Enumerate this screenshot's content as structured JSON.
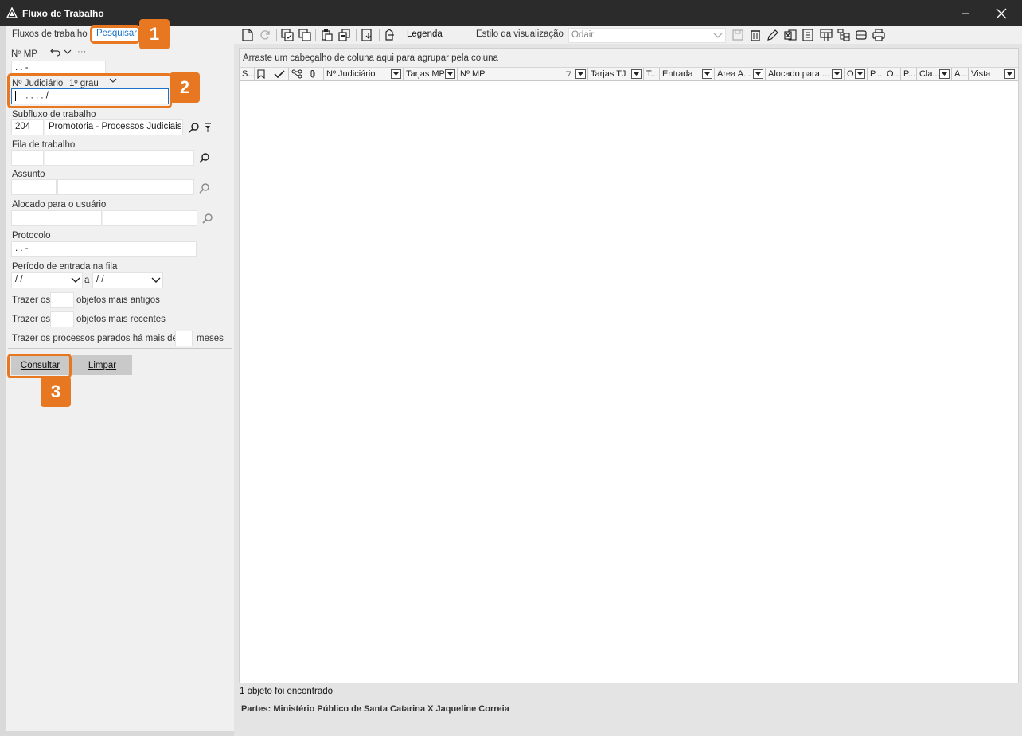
{
  "window": {
    "title": "Fluxo de Trabalho"
  },
  "tabs": {
    "fluxos": "Fluxos de trabalho",
    "pesquisar": "Pesquisar"
  },
  "form": {
    "nmp_label": "Nº MP",
    "nmp_value": " .  .      -",
    "njud_label": "Nº Judiciário",
    "njud_grau": "1º grau",
    "njud_value": "    -  .     .  .   .   /",
    "subfluxo_label": "Subfluxo de trabalho",
    "subfluxo_code": "204",
    "subfluxo_name": "Promotoria - Processos Judiciais",
    "fila_label": "Fila de trabalho",
    "fila_code": "",
    "fila_name": "",
    "assunto_label": "Assunto",
    "assunto_code": "",
    "assunto_name": "",
    "alocado_label": "Alocado para o usuário",
    "alocado_code": "",
    "alocado_name": "",
    "protocolo_label": "Protocolo",
    "protocolo_value": "  .  .        -",
    "periodo_label": "Período de entrada na fila",
    "periodo_de": " /  /",
    "periodo_a_label": "a",
    "periodo_ate": " /  /",
    "trazer_os": "Trazer os",
    "antigos_label": "objetos mais antigos",
    "antigos_value": "",
    "recentes_label": "objetos mais recentes",
    "recentes_value": "",
    "parados_label": "Trazer os processos parados há mais de",
    "parados_value": "",
    "meses_label": "meses",
    "consultar": "Consultar",
    "limpar": "Limpar"
  },
  "toolbar": {
    "legenda": "Legenda",
    "estilo_label": "Estilo da visualização",
    "estilo_value": "Odair"
  },
  "grid": {
    "group_hint": "Arraste um cabeçalho de coluna aqui para agrupar pela coluna",
    "columns": [
      "S...",
      "",
      "",
      "",
      "",
      "Nº Judiciário",
      "Tarjas MP",
      "Nº MP",
      "Tarjas TJ",
      "T...",
      "Entrada",
      "Área A...",
      "Alocado para ...",
      "O",
      "P...",
      "O...",
      "P...",
      "Cla...",
      "A...",
      "Vista"
    ]
  },
  "status": {
    "found": "1 objeto foi encontrado",
    "partes": "Partes: Ministério Público de Santa Catarina  X  Jaqueline Correia"
  },
  "callouts": [
    "1",
    "2",
    "3"
  ],
  "colors": {
    "accent": "#e87722",
    "link": "#1a73c8",
    "titlebar": "#2b2b2b"
  }
}
